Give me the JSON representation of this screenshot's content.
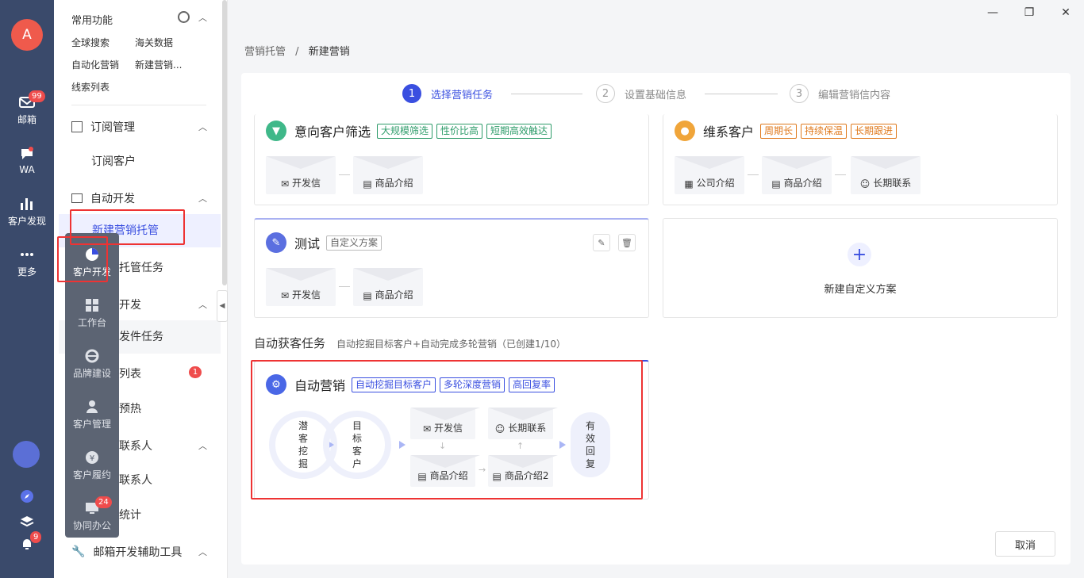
{
  "rail": {
    "avatar": "A",
    "mail": {
      "label": "邮箱",
      "badge": "99"
    },
    "wa": {
      "label": "WA"
    },
    "discover": {
      "label": "客户发现"
    },
    "more": {
      "label": "更多"
    },
    "bell_badge": "9"
  },
  "sidebar": {
    "fav_title": "常用功能",
    "fav_links": [
      "全球搜索",
      "海关数据",
      "自动化营销",
      "新建营销...",
      "线索列表"
    ],
    "sections": [
      {
        "label": "订阅管理",
        "items": [
          "订阅客户"
        ]
      },
      {
        "label": "自动开发",
        "items": [
          "新建营销托管",
          "托管任务"
        ]
      },
      {
        "label": "开发",
        "items": [
          "发件任务",
          "列表",
          "预热"
        ]
      },
      {
        "label": "联系人",
        "items": [
          "联系人",
          "统计"
        ]
      },
      {
        "label": "邮箱开发辅助工具"
      }
    ],
    "list_badge": "1"
  },
  "flyout": {
    "items": [
      {
        "label": "客户开发",
        "icon": "pie-chart-icon"
      },
      {
        "label": "工作台",
        "icon": "grid-icon"
      },
      {
        "label": "品牌建设",
        "icon": "ie-icon"
      },
      {
        "label": "客户管理",
        "icon": "user-icon"
      },
      {
        "label": "客户履约",
        "icon": "yen-icon"
      },
      {
        "label": "协同办公",
        "icon": "monitor-icon",
        "badge": "24"
      }
    ]
  },
  "window": {
    "minimize": "—",
    "restore": "❐",
    "close": "✕"
  },
  "breadcrumb": {
    "root": "营销托管",
    "sep": "/",
    "current": "新建营销"
  },
  "steps": [
    {
      "num": "1",
      "label": "选择营销任务"
    },
    {
      "num": "2",
      "label": "设置基础信息"
    },
    {
      "num": "3",
      "label": "编辑营销信内容"
    }
  ],
  "cards": {
    "intent": {
      "title": "意向客户筛选",
      "tags": [
        "大规模筛选",
        "性价比高",
        "短期高效触达"
      ],
      "envelopes": [
        "开发信",
        "商品介绍"
      ]
    },
    "maintain": {
      "title": "维系客户",
      "tags": [
        "周期长",
        "持续保温",
        "长期跟进"
      ],
      "envelopes": [
        "公司介绍",
        "商品介绍",
        "长期联系"
      ]
    },
    "test": {
      "title": "测试",
      "tags": [
        "自定义方案"
      ],
      "envelopes": [
        "开发信",
        "商品介绍"
      ]
    },
    "new_custom": {
      "label": "新建自定义方案",
      "plus": "+"
    }
  },
  "auto_section": {
    "title": "自动获客任务",
    "subtitle": "自动挖掘目标客户+自动完成多轮营销（已创建1/10）"
  },
  "auto_card": {
    "title": "自动营销",
    "tags": [
      "自动挖掘目标客户",
      "多轮深度营销",
      "高回复率"
    ],
    "potential": "潜\n客\n挖\n掘",
    "target": "目\n标\n客\n户",
    "env_dev": "开发信",
    "env_long": "长期联系",
    "env_prod": "商品介绍",
    "env_prod2": "商品介绍2",
    "reply": "有\n效\n回\n复"
  },
  "footer": {
    "cancel": "取消"
  },
  "colors": {
    "accent": "#3a4fe0",
    "rail": "#3a4a6b",
    "highlight": "#e33333"
  }
}
